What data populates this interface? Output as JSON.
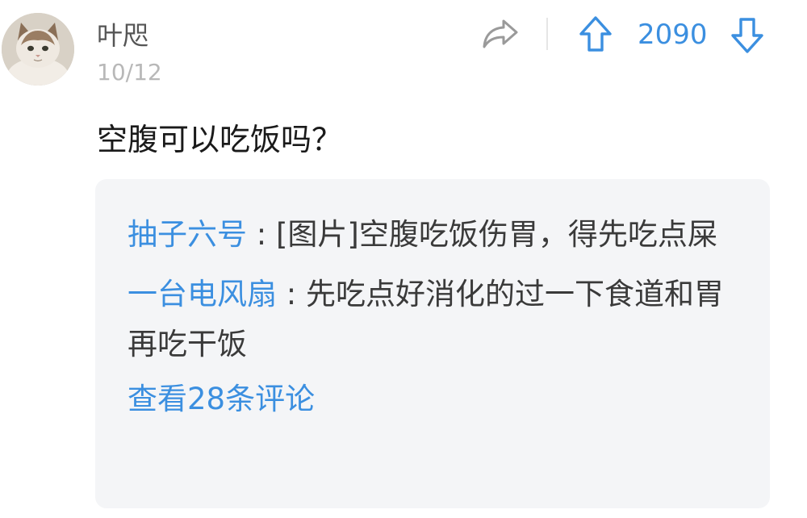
{
  "post": {
    "username": "叶咫",
    "date": "10/12",
    "question": "空腹可以吃饭吗？",
    "vote_count": "2090"
  },
  "icons": {
    "share": "share-icon",
    "upvote": "arrow-up-icon",
    "downvote": "arrow-down-icon",
    "avatar": "cat-avatar"
  },
  "colors": {
    "accent": "#3b8fe0",
    "comment_bg": "#f4f5f7",
    "date": "#b8b8b8"
  },
  "comments": {
    "items": [
      {
        "author": "抽子六号",
        "separator": " : ",
        "text": "[图片]空腹吃饭伤胃，得先吃点屎"
      },
      {
        "author": "一台电风扇",
        "separator": " : ",
        "text": "先吃点好消化的过一下食道和胃再吃干饭"
      }
    ],
    "view_all": "查看28条评论"
  }
}
